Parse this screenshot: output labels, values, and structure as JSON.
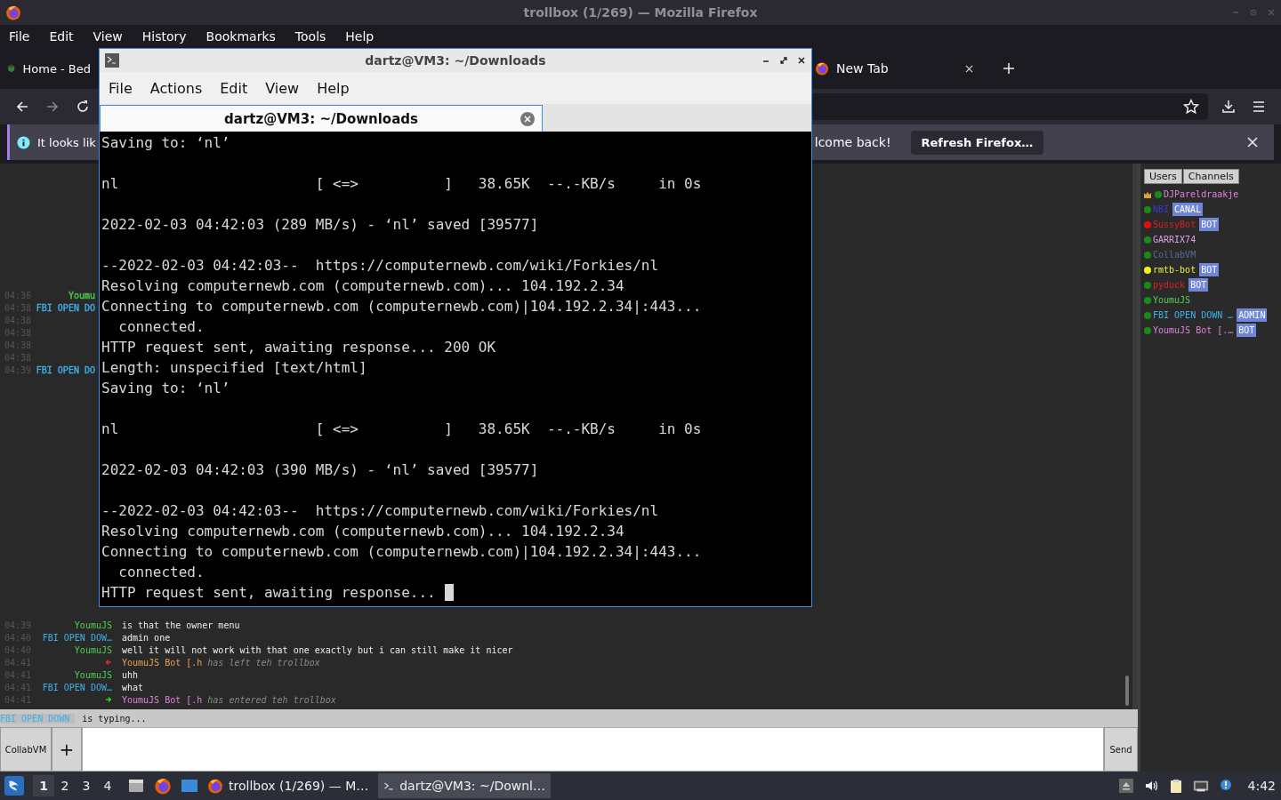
{
  "browser": {
    "title": "trollbox (1/269) — Mozilla Firefox",
    "menu": [
      "File",
      "Edit",
      "View",
      "History",
      "Bookmarks",
      "Tools",
      "Help"
    ],
    "tabs": [
      {
        "label": "Home - Bed",
        "kind": "site",
        "selected": false
      },
      {
        "label": "New Tab",
        "kind": "newtab",
        "selected": false
      }
    ],
    "notification": {
      "text_left": "It looks lik",
      "text_right": "lcome back!",
      "button": "Refresh Firefox…"
    }
  },
  "chat": {
    "earlier": [
      {
        "time": "04:36",
        "name": "Youmu",
        "color": "#4fd14f"
      },
      {
        "time": "04:38",
        "name": "FBI OPEN DO",
        "color": "#3fb0e8"
      },
      {
        "time": "04:38"
      },
      {
        "time": "04:38"
      },
      {
        "time": "04:38"
      },
      {
        "time": "04:38"
      },
      {
        "time": "04:39",
        "name": "FBI OPEN DO",
        "color": "#3fb0e8"
      }
    ],
    "messages": [
      {
        "time": "04:39",
        "kind": "message",
        "name": "YoumuJS",
        "color": "#4fd14f",
        "text": "is that the owner menu"
      },
      {
        "time": "04:40",
        "kind": "message",
        "name": "FBI OPEN DOW…",
        "color": "#3fb0e8",
        "text": "admin one"
      },
      {
        "time": "04:40",
        "kind": "message",
        "name": "YoumuJS",
        "color": "#4fd14f",
        "text": "well it will not work with that one exactly but i can still make it nicer"
      },
      {
        "time": "04:41",
        "kind": "left",
        "name": "YoumuJS Bot [.h",
        "color": "#e8a050",
        "text": "has left teh trollbox"
      },
      {
        "time": "04:41",
        "kind": "message",
        "name": "YoumuJS",
        "color": "#4fd14f",
        "text": "uhh"
      },
      {
        "time": "04:41",
        "kind": "message",
        "name": "FBI OPEN DOW…",
        "color": "#3fb0e8",
        "text": "what"
      },
      {
        "time": "04:41",
        "kind": "joined",
        "name": "YoumuJS Bot [.h",
        "color": "#e080e0",
        "text": "has entered teh trollbox"
      }
    ],
    "typing": {
      "name": "FBI OPEN DOWN",
      "text": "is typing..."
    },
    "input": {
      "channel": "CollabVM",
      "add": "+",
      "send": "Send"
    }
  },
  "users_panel": {
    "tabs": [
      "Users",
      "Channels"
    ],
    "users": [
      {
        "name": "DJPareldraakje",
        "color": "#e080e0",
        "dot": {
          "color": "#1a8a1a"
        },
        "owner": true
      },
      {
        "name": "NBI",
        "color": "#3a3ad8",
        "dot": {
          "color": "#1a8a1a"
        },
        "owner": false,
        "badge": "CANAL"
      },
      {
        "name": "SussyBot",
        "color": "#e02020",
        "dot": {
          "color": "#e01010"
        },
        "owner": false,
        "badge": "BOT"
      },
      {
        "name": "GARRIX74",
        "color": "#e0a0e0",
        "dot": {
          "color": "#1a8a1a"
        },
        "owner": false
      },
      {
        "name": "CollabVM",
        "color": "#5a6c94",
        "dot": {
          "color": "#1a8a1a"
        },
        "owner": false
      },
      {
        "name": "rmtb-bot",
        "color": "#f0f040",
        "dot": {
          "color": "#f0f020"
        },
        "owner": false,
        "badge": "BOT"
      },
      {
        "name": "pyduck",
        "color": "#e02020",
        "dot": {
          "color": "#1a8a1a"
        },
        "owner": false,
        "badge": "BOT"
      },
      {
        "name": "YoumuJS",
        "color": "#4fd14f",
        "dot": {
          "color": "#1a8a1a"
        },
        "owner": false
      },
      {
        "name": "FBI OPEN DOWN …",
        "color": "#3fb0e8",
        "dot": {
          "color": "#1a8a1a"
        },
        "owner": false,
        "badge": "ADMIN"
      },
      {
        "name": "YoumuJS Bot [.…",
        "color": "#e080e0",
        "dot": {
          "color": "#1a8a1a"
        },
        "owner": false,
        "badge": "BOT"
      }
    ]
  },
  "terminal": {
    "title": "dartz@VM3: ~/Downloads",
    "menu": [
      "File",
      "Actions",
      "Edit",
      "View",
      "Help"
    ],
    "tab": "dartz@VM3: ~/Downloads",
    "cursor": true,
    "blocks": [
      [
        "Saving to: ‘nl’"
      ],
      [
        "nl                       [ <=>          ]   38.65K  --.-KB/s     in 0s"
      ],
      [
        "2022-02-03 04:42:03 (289 MB/s) - ‘nl’ saved [39577]"
      ],
      [
        "--2022-02-03 04:42:03--  https://computernewb.com/wiki/Forkies/nl",
        "Resolving computernewb.com (computernewb.com)... 104.192.2.34",
        "Connecting to computernewb.com (computernewb.com)|104.192.2.34|:443...",
        "  connected.",
        "HTTP request sent, awaiting response... 200 OK",
        "Length: unspecified [text/html]",
        "Saving to: ‘nl’"
      ],
      [
        "nl                       [ <=>          ]   38.65K  --.-KB/s     in 0s"
      ],
      [
        "2022-02-03 04:42:03 (390 MB/s) - ‘nl’ saved [39577]"
      ],
      [
        "--2022-02-03 04:42:03--  https://computernewb.com/wiki/Forkies/nl",
        "Resolving computernewb.com (computernewb.com)... 104.192.2.34",
        "Connecting to computernewb.com (computernewb.com)|104.192.2.34|:443...",
        "  connected.",
        "HTTP request sent, awaiting response... "
      ]
    ]
  },
  "taskbar": {
    "workspaces": [
      {
        "label": "1",
        "selected": true
      },
      {
        "label": "2",
        "selected": false
      },
      {
        "label": "3",
        "selected": false
      },
      {
        "label": "4",
        "selected": false
      }
    ],
    "tasks": [
      {
        "label": "trollbox (1/269) — M…",
        "kind": "browser",
        "selected": false
      },
      {
        "label": "dartz@VM3: ~/Downl…",
        "kind": "terminal",
        "selected": true
      }
    ],
    "clock": "4:42"
  }
}
